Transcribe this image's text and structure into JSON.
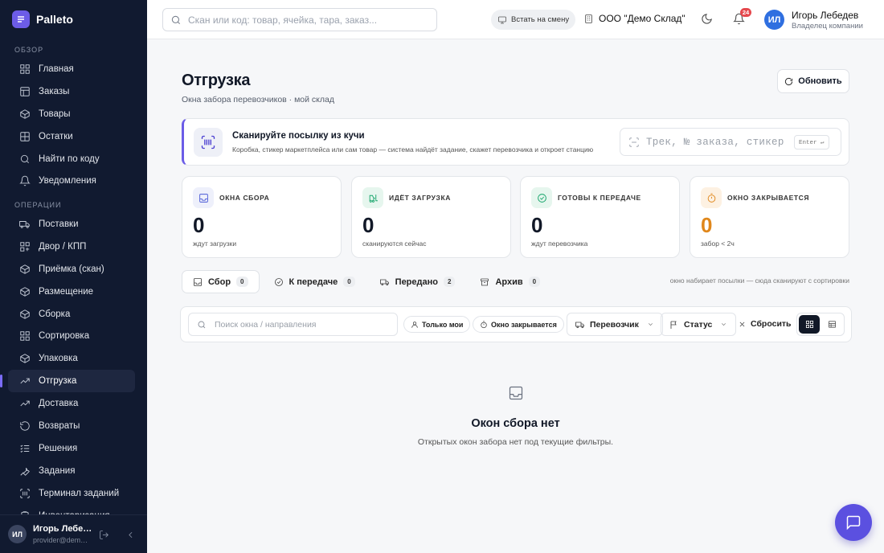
{
  "app": {
    "name": "Palleto"
  },
  "sidebar": {
    "sections": [
      {
        "label": "ОБЗОР",
        "items": [
          {
            "label": "Главная",
            "icon": "dashboard-icon"
          },
          {
            "label": "Заказы",
            "icon": "orders-icon"
          },
          {
            "label": "Товары",
            "icon": "box-icon"
          },
          {
            "label": "Остатки",
            "icon": "stock-icon"
          },
          {
            "label": "Найти по коду",
            "icon": "search-icon"
          },
          {
            "label": "Уведомления",
            "icon": "bell-icon"
          }
        ]
      },
      {
        "label": "ОПЕРАЦИИ",
        "items": [
          {
            "label": "Поставки",
            "icon": "truck-icon"
          },
          {
            "label": "Двор / КПП",
            "icon": "yard-icon"
          },
          {
            "label": "Приёмка (скан)",
            "icon": "box-icon"
          },
          {
            "label": "Размещение",
            "icon": "box-icon"
          },
          {
            "label": "Сборка",
            "icon": "box-icon"
          },
          {
            "label": "Сортировка",
            "icon": "grid-icon"
          },
          {
            "label": "Упаковка",
            "icon": "box-icon"
          },
          {
            "label": "Отгрузка",
            "icon": "trend-icon",
            "active": true
          },
          {
            "label": "Доставка",
            "icon": "trend-icon"
          },
          {
            "label": "Возвраты",
            "icon": "return-icon"
          },
          {
            "label": "Решения",
            "icon": "list-check-icon"
          },
          {
            "label": "Задания",
            "icon": "wrench-icon"
          },
          {
            "label": "Терминал заданий",
            "icon": "terminal-icon"
          },
          {
            "label": "Инвентаризация",
            "icon": "clipboard-icon"
          }
        ]
      }
    ],
    "footer": {
      "initials": "ИЛ",
      "name": "Игорь Лебе…",
      "email": "provider@dem…"
    }
  },
  "topbar": {
    "search_placeholder": "Скан или код: товар, ячейка, тара, заказ...",
    "shift_label": "Встать на смену",
    "company": "ООО \"Демо Склад\"",
    "notifications_count": "24",
    "user": {
      "initials": "ИЛ",
      "name": "Игорь Лебедев",
      "role": "Владелец компании"
    }
  },
  "page": {
    "title": "Отгрузка",
    "subtitle": "Окна забора перевозчиков · мой склад",
    "refresh_label": "Обновить"
  },
  "scan": {
    "title": "Сканируйте посылку из кучи",
    "description": "Коробка, стикер маркетплейса или сам товар — система найдёт задание, скажет перевозчика и откроет станцию",
    "placeholder": "Трек, № заказа, стикер МП",
    "key_hint": "Enter ↵"
  },
  "kpis": [
    {
      "label": "ОКНА СБОРА",
      "value": "0",
      "note": "ждут загрузки",
      "icon": "inbox-icon",
      "accent": "#4a5ad6",
      "bg": "#eef0fb",
      "value_color": "#111827"
    },
    {
      "label": "ИДЁТ ЗАГРУЗКА",
      "value": "0",
      "note": "сканируются сейчас",
      "icon": "forklift-icon",
      "accent": "#17a56b",
      "bg": "#e6f6ee",
      "value_color": "#111827"
    },
    {
      "label": "ГОТОВЫ К ПЕРЕДАЧЕ",
      "value": "0",
      "note": "ждут перевозчика",
      "icon": "check-circle-icon",
      "accent": "#17a56b",
      "bg": "#e6f6ee",
      "value_color": "#111827"
    },
    {
      "label": "ОКНО ЗАКРЫВАЕТСЯ",
      "value": "0",
      "note": "забор < 2ч",
      "icon": "timer-icon",
      "accent": "#e0871b",
      "bg": "#fdf1e2",
      "value_color": "#e0871b"
    }
  ],
  "tabs": [
    {
      "label": "Сбор",
      "count": "0",
      "icon": "inbox-icon",
      "active": true
    },
    {
      "label": "К передаче",
      "count": "0",
      "icon": "check-circle-icon"
    },
    {
      "label": "Передано",
      "count": "2",
      "icon": "truck-icon"
    },
    {
      "label": "Архив",
      "count": "0",
      "icon": "archive-icon"
    }
  ],
  "tabs_hint": "окно набирает посылки — сюда сканируют с сортировки",
  "filters": {
    "search_placeholder": "Поиск окна / направления",
    "only_mine": "Только мои",
    "closing": "Окно закрывается",
    "carrier": "Перевозчик",
    "status": "Статус",
    "reset": "Сбросить"
  },
  "empty": {
    "title": "Окон сбора нет",
    "subtitle": "Открытых окон забора нет под текущие фильтры."
  }
}
